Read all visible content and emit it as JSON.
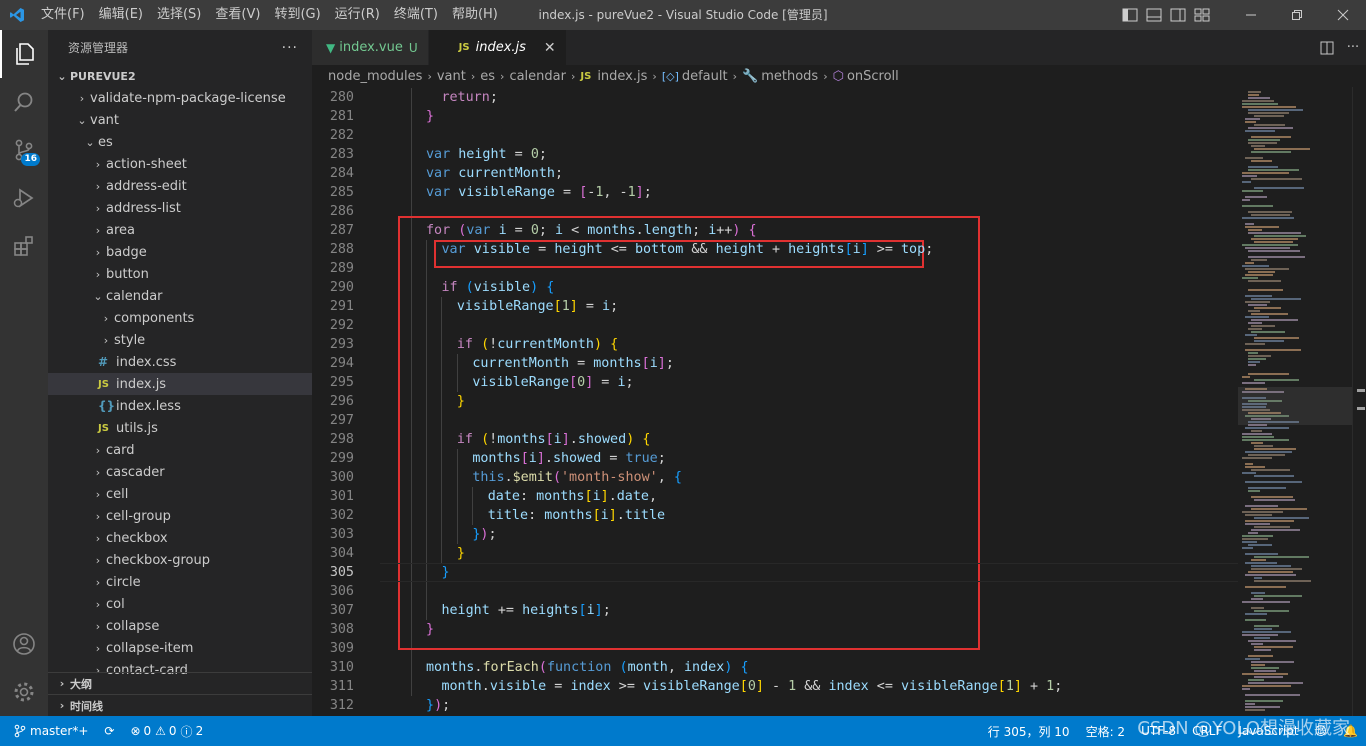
{
  "window": {
    "menu": [
      "文件(F)",
      "编辑(E)",
      "选择(S)",
      "查看(V)",
      "转到(G)",
      "运行(R)",
      "终端(T)",
      "帮助(H)"
    ],
    "title": "index.js - pureVue2 - Visual Studio Code [管理员]"
  },
  "activity_bar": {
    "scm_badge": "16"
  },
  "sidebar": {
    "title": "资源管理器",
    "root": "PUREVUE2",
    "tree": [
      {
        "label": "validate-npm-package-license",
        "depth": 1,
        "kind": "folder",
        "open": false
      },
      {
        "label": "vant",
        "depth": 1,
        "kind": "folder",
        "open": true
      },
      {
        "label": "es",
        "depth": 2,
        "kind": "folder",
        "open": true
      },
      {
        "label": "action-sheet",
        "depth": 3,
        "kind": "folder",
        "open": false
      },
      {
        "label": "address-edit",
        "depth": 3,
        "kind": "folder",
        "open": false
      },
      {
        "label": "address-list",
        "depth": 3,
        "kind": "folder",
        "open": false
      },
      {
        "label": "area",
        "depth": 3,
        "kind": "folder",
        "open": false
      },
      {
        "label": "badge",
        "depth": 3,
        "kind": "folder",
        "open": false
      },
      {
        "label": "button",
        "depth": 3,
        "kind": "folder",
        "open": false
      },
      {
        "label": "calendar",
        "depth": 3,
        "kind": "folder",
        "open": true
      },
      {
        "label": "components",
        "depth": 4,
        "kind": "folder",
        "open": false
      },
      {
        "label": "style",
        "depth": 4,
        "kind": "folder",
        "open": false
      },
      {
        "label": "index.css",
        "depth": 4,
        "kind": "css"
      },
      {
        "label": "index.js",
        "depth": 4,
        "kind": "js",
        "selected": true
      },
      {
        "label": "index.less",
        "depth": 4,
        "kind": "less"
      },
      {
        "label": "utils.js",
        "depth": 4,
        "kind": "js"
      },
      {
        "label": "card",
        "depth": 3,
        "kind": "folder",
        "open": false
      },
      {
        "label": "cascader",
        "depth": 3,
        "kind": "folder",
        "open": false
      },
      {
        "label": "cell",
        "depth": 3,
        "kind": "folder",
        "open": false
      },
      {
        "label": "cell-group",
        "depth": 3,
        "kind": "folder",
        "open": false
      },
      {
        "label": "checkbox",
        "depth": 3,
        "kind": "folder",
        "open": false
      },
      {
        "label": "checkbox-group",
        "depth": 3,
        "kind": "folder",
        "open": false
      },
      {
        "label": "circle",
        "depth": 3,
        "kind": "folder",
        "open": false
      },
      {
        "label": "col",
        "depth": 3,
        "kind": "folder",
        "open": false
      },
      {
        "label": "collapse",
        "depth": 3,
        "kind": "folder",
        "open": false
      },
      {
        "label": "collapse-item",
        "depth": 3,
        "kind": "folder",
        "open": false
      },
      {
        "label": "contact-card",
        "depth": 3,
        "kind": "folder",
        "open": false
      }
    ],
    "outline": "大纲",
    "timeline": "时间线"
  },
  "tabs": [
    {
      "label": "index.vue",
      "status": "U",
      "active": false
    },
    {
      "label": "index.js",
      "active": true
    }
  ],
  "breadcrumb": [
    "node_modules",
    "vant",
    "es",
    "calendar",
    "index.js",
    "default",
    "methods",
    "onScroll"
  ],
  "editor": {
    "current_line": 305,
    "lines": [
      {
        "n": 280,
        "indent": 2,
        "t": [
          [
            "ctl",
            "return"
          ],
          [
            "p",
            ";"
          ]
        ]
      },
      {
        "n": 281,
        "indent": 1,
        "t": [
          [
            "b2",
            "}"
          ]
        ]
      },
      {
        "n": 282,
        "indent": 0,
        "t": []
      },
      {
        "n": 283,
        "indent": 1,
        "t": [
          [
            "kw",
            "var"
          ],
          [
            "p",
            " "
          ],
          [
            "var",
            "height"
          ],
          [
            "p",
            " = "
          ],
          [
            "num",
            "0"
          ],
          [
            "p",
            ";"
          ]
        ]
      },
      {
        "n": 284,
        "indent": 1,
        "t": [
          [
            "kw",
            "var"
          ],
          [
            "p",
            " "
          ],
          [
            "var",
            "currentMonth"
          ],
          [
            "p",
            ";"
          ]
        ]
      },
      {
        "n": 285,
        "indent": 1,
        "t": [
          [
            "kw",
            "var"
          ],
          [
            "p",
            " "
          ],
          [
            "var",
            "visibleRange"
          ],
          [
            "p",
            " = "
          ],
          [
            "b2",
            "["
          ],
          [
            "p",
            "-"
          ],
          [
            "num",
            "1"
          ],
          [
            "p",
            ", -"
          ],
          [
            "num",
            "1"
          ],
          [
            "b2",
            "]"
          ],
          [
            "p",
            ";"
          ]
        ]
      },
      {
        "n": 286,
        "indent": 0,
        "t": []
      },
      {
        "n": 287,
        "indent": 1,
        "t": [
          [
            "ctl",
            "for"
          ],
          [
            "p",
            " "
          ],
          [
            "b2",
            "("
          ],
          [
            "kw",
            "var"
          ],
          [
            "p",
            " "
          ],
          [
            "var",
            "i"
          ],
          [
            "p",
            " = "
          ],
          [
            "num",
            "0"
          ],
          [
            "p",
            "; "
          ],
          [
            "var",
            "i"
          ],
          [
            "p",
            " < "
          ],
          [
            "var",
            "months"
          ],
          [
            "p",
            "."
          ],
          [
            "var",
            "length"
          ],
          [
            "p",
            "; "
          ],
          [
            "var",
            "i"
          ],
          [
            "p",
            "++"
          ],
          [
            "b2",
            ")"
          ],
          [
            "p",
            " "
          ],
          [
            "b2",
            "{"
          ]
        ]
      },
      {
        "n": 288,
        "indent": 2,
        "t": [
          [
            "kw",
            "var"
          ],
          [
            "p",
            " "
          ],
          [
            "var",
            "visible"
          ],
          [
            "p",
            " = "
          ],
          [
            "var",
            "height"
          ],
          [
            "p",
            " <= "
          ],
          [
            "var",
            "bottom"
          ],
          [
            "p",
            " && "
          ],
          [
            "var",
            "height"
          ],
          [
            "p",
            " + "
          ],
          [
            "var",
            "heights"
          ],
          [
            "b3",
            "["
          ],
          [
            "var",
            "i"
          ],
          [
            "b3",
            "]"
          ],
          [
            "p",
            " >= "
          ],
          [
            "var",
            "top"
          ],
          [
            "p",
            ";"
          ]
        ]
      },
      {
        "n": 289,
        "indent": 0,
        "t": []
      },
      {
        "n": 290,
        "indent": 2,
        "t": [
          [
            "ctl",
            "if"
          ],
          [
            "p",
            " "
          ],
          [
            "b3",
            "("
          ],
          [
            "var",
            "visible"
          ],
          [
            "b3",
            ")"
          ],
          [
            "p",
            " "
          ],
          [
            "b3",
            "{"
          ]
        ]
      },
      {
        "n": 291,
        "indent": 3,
        "t": [
          [
            "var",
            "visibleRange"
          ],
          [
            "b1",
            "["
          ],
          [
            "num",
            "1"
          ],
          [
            "b1",
            "]"
          ],
          [
            "p",
            " = "
          ],
          [
            "var",
            "i"
          ],
          [
            "p",
            ";"
          ]
        ]
      },
      {
        "n": 292,
        "indent": 0,
        "t": []
      },
      {
        "n": 293,
        "indent": 3,
        "t": [
          [
            "ctl",
            "if"
          ],
          [
            "p",
            " "
          ],
          [
            "b1",
            "("
          ],
          [
            "p",
            "!"
          ],
          [
            "var",
            "currentMonth"
          ],
          [
            "b1",
            ")"
          ],
          [
            "p",
            " "
          ],
          [
            "b1",
            "{"
          ]
        ]
      },
      {
        "n": 294,
        "indent": 4,
        "t": [
          [
            "var",
            "currentMonth"
          ],
          [
            "p",
            " = "
          ],
          [
            "var",
            "months"
          ],
          [
            "b2",
            "["
          ],
          [
            "var",
            "i"
          ],
          [
            "b2",
            "]"
          ],
          [
            "p",
            ";"
          ]
        ]
      },
      {
        "n": 295,
        "indent": 4,
        "t": [
          [
            "var",
            "visibleRange"
          ],
          [
            "b2",
            "["
          ],
          [
            "num",
            "0"
          ],
          [
            "b2",
            "]"
          ],
          [
            "p",
            " = "
          ],
          [
            "var",
            "i"
          ],
          [
            "p",
            ";"
          ]
        ]
      },
      {
        "n": 296,
        "indent": 3,
        "t": [
          [
            "b1",
            "}"
          ]
        ]
      },
      {
        "n": 297,
        "indent": 0,
        "t": []
      },
      {
        "n": 298,
        "indent": 3,
        "t": [
          [
            "ctl",
            "if"
          ],
          [
            "p",
            " "
          ],
          [
            "b1",
            "("
          ],
          [
            "p",
            "!"
          ],
          [
            "var",
            "months"
          ],
          [
            "b2",
            "["
          ],
          [
            "var",
            "i"
          ],
          [
            "b2",
            "]"
          ],
          [
            "p",
            "."
          ],
          [
            "var",
            "showed"
          ],
          [
            "b1",
            ")"
          ],
          [
            "p",
            " "
          ],
          [
            "b1",
            "{"
          ]
        ]
      },
      {
        "n": 299,
        "indent": 4,
        "t": [
          [
            "var",
            "months"
          ],
          [
            "b2",
            "["
          ],
          [
            "var",
            "i"
          ],
          [
            "b2",
            "]"
          ],
          [
            "p",
            "."
          ],
          [
            "var",
            "showed"
          ],
          [
            "p",
            " = "
          ],
          [
            "kw",
            "true"
          ],
          [
            "p",
            ";"
          ]
        ]
      },
      {
        "n": 300,
        "indent": 4,
        "t": [
          [
            "kw",
            "this"
          ],
          [
            "p",
            "."
          ],
          [
            "fn",
            "$emit"
          ],
          [
            "b2",
            "("
          ],
          [
            "str",
            "'month-show'"
          ],
          [
            "p",
            ", "
          ],
          [
            "b3",
            "{"
          ]
        ]
      },
      {
        "n": 301,
        "indent": 5,
        "t": [
          [
            "var",
            "date"
          ],
          [
            "p",
            ": "
          ],
          [
            "var",
            "months"
          ],
          [
            "b1",
            "["
          ],
          [
            "var",
            "i"
          ],
          [
            "b1",
            "]"
          ],
          [
            "p",
            "."
          ],
          [
            "var",
            "date"
          ],
          [
            "p",
            ","
          ]
        ]
      },
      {
        "n": 302,
        "indent": 5,
        "t": [
          [
            "var",
            "title"
          ],
          [
            "p",
            ": "
          ],
          [
            "var",
            "months"
          ],
          [
            "b1",
            "["
          ],
          [
            "var",
            "i"
          ],
          [
            "b1",
            "]"
          ],
          [
            "p",
            "."
          ],
          [
            "var",
            "title"
          ]
        ]
      },
      {
        "n": 303,
        "indent": 4,
        "t": [
          [
            "b3",
            "}"
          ],
          [
            "b2",
            ")"
          ],
          [
            "p",
            ";"
          ]
        ]
      },
      {
        "n": 304,
        "indent": 3,
        "t": [
          [
            "b1",
            "}"
          ]
        ]
      },
      {
        "n": 305,
        "indent": 2,
        "t": [
          [
            "b3",
            "}"
          ]
        ]
      },
      {
        "n": 306,
        "indent": 0,
        "t": []
      },
      {
        "n": 307,
        "indent": 2,
        "t": [
          [
            "var",
            "height"
          ],
          [
            "p",
            " += "
          ],
          [
            "var",
            "heights"
          ],
          [
            "b3",
            "["
          ],
          [
            "var",
            "i"
          ],
          [
            "b3",
            "]"
          ],
          [
            "p",
            ";"
          ]
        ]
      },
      {
        "n": 308,
        "indent": 1,
        "t": [
          [
            "b2",
            "}"
          ]
        ]
      },
      {
        "n": 309,
        "indent": 0,
        "t": []
      },
      {
        "n": 310,
        "indent": 1,
        "t": [
          [
            "var",
            "months"
          ],
          [
            "p",
            "."
          ],
          [
            "fn",
            "forEach"
          ],
          [
            "b2",
            "("
          ],
          [
            "kw",
            "function"
          ],
          [
            "p",
            " "
          ],
          [
            "b3",
            "("
          ],
          [
            "var",
            "month"
          ],
          [
            "p",
            ", "
          ],
          [
            "var",
            "index"
          ],
          [
            "b3",
            ")"
          ],
          [
            "p",
            " "
          ],
          [
            "b3",
            "{"
          ]
        ]
      },
      {
        "n": 311,
        "indent": 2,
        "t": [
          [
            "var",
            "month"
          ],
          [
            "p",
            "."
          ],
          [
            "var",
            "visible"
          ],
          [
            "p",
            " = "
          ],
          [
            "var",
            "index"
          ],
          [
            "p",
            " >= "
          ],
          [
            "var",
            "visibleRange"
          ],
          [
            "b1",
            "["
          ],
          [
            "num",
            "0"
          ],
          [
            "b1",
            "]"
          ],
          [
            "p",
            " - "
          ],
          [
            "num",
            "1"
          ],
          [
            "p",
            " && "
          ],
          [
            "var",
            "index"
          ],
          [
            "p",
            " <= "
          ],
          [
            "var",
            "visibleRange"
          ],
          [
            "b1",
            "["
          ],
          [
            "num",
            "1"
          ],
          [
            "b1",
            "]"
          ],
          [
            "p",
            " + "
          ],
          [
            "num",
            "1"
          ],
          [
            "p",
            ";"
          ]
        ]
      },
      {
        "n": 312,
        "indent": 1,
        "t": [
          [
            "b3",
            "}"
          ],
          [
            "b2",
            ")"
          ],
          [
            "p",
            ";"
          ]
        ]
      }
    ]
  },
  "statusbar": {
    "branch": "master*+",
    "errors": "0",
    "warnings": "0",
    "info": "2",
    "cursor": "行 305，列 10",
    "spaces": "空格: 2",
    "encoding": "UTF-8",
    "eol": "CRLF",
    "language": "JavaScript"
  },
  "watermark": "CSDN @YOLO想漫收藏家"
}
